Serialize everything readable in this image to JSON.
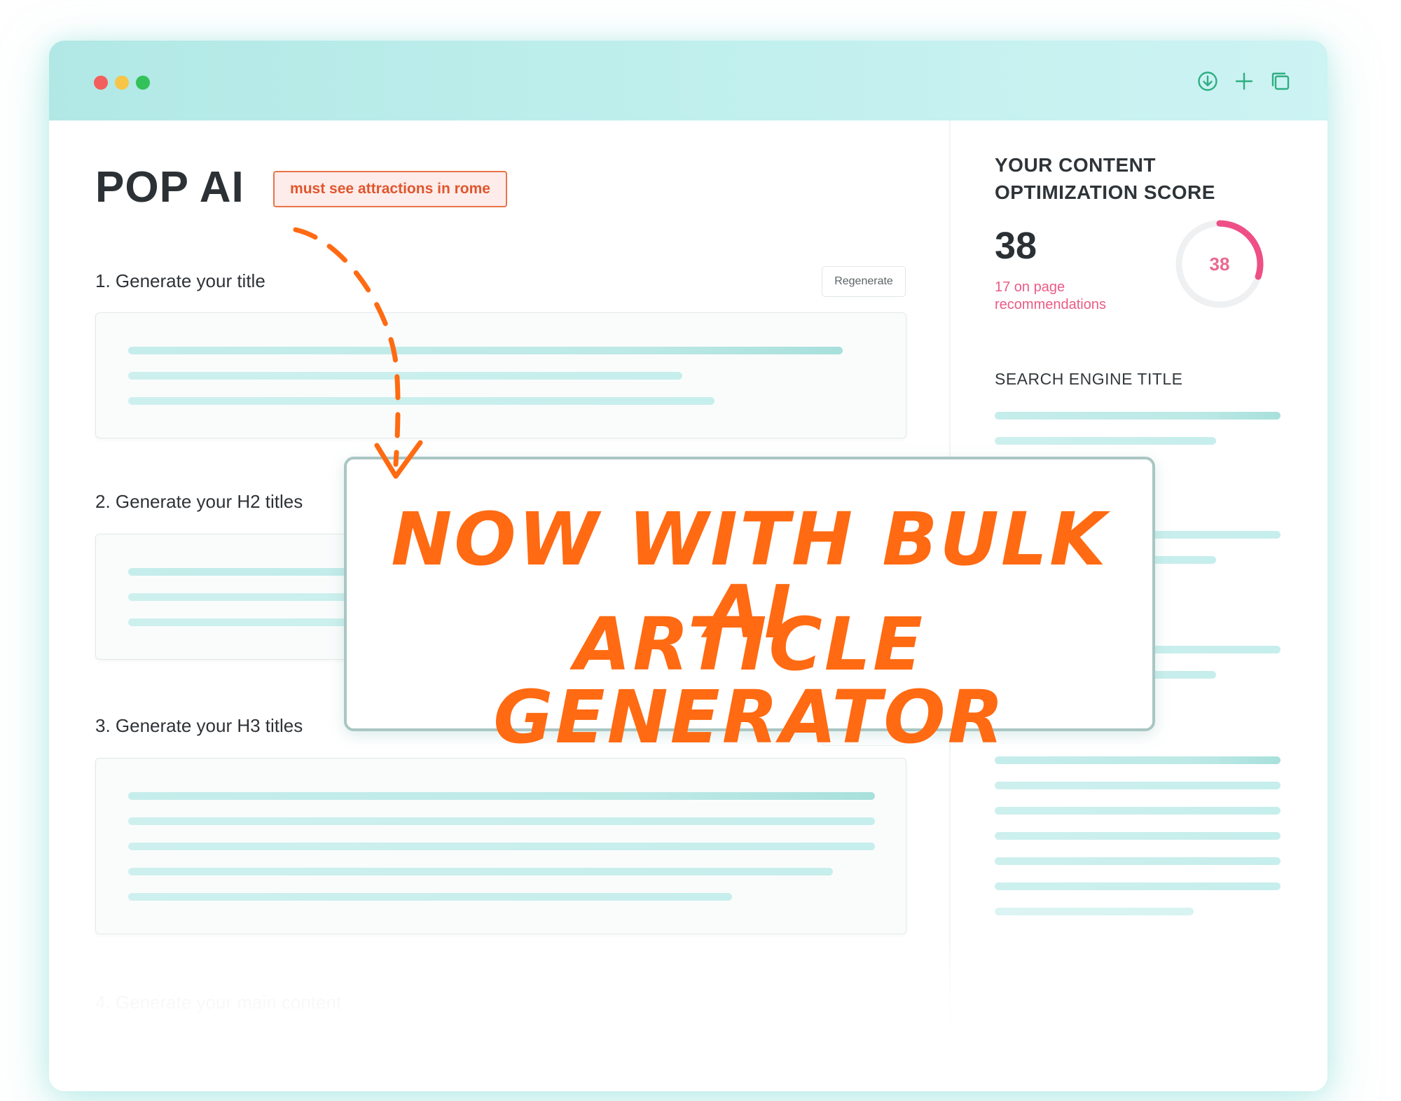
{
  "window": {
    "title_bar_icons": [
      "download-icon",
      "plus-icon",
      "copy-icon"
    ]
  },
  "brand": {
    "name": "POP AI"
  },
  "keyword_tag": "must see attractions in rome",
  "steps": [
    {
      "label": "1. Generate your title",
      "button": "Regenerate"
    },
    {
      "label": "2. Generate your H2 titles"
    },
    {
      "label": "3. Generate your H3 titles"
    },
    {
      "label": "4. Generate your main content"
    }
  ],
  "score_panel": {
    "heading": "YOUR CONTENT OPTIMIZATION SCORE",
    "score": "38",
    "gauge_value": "38",
    "gauge_fraction": 0.3,
    "recommendations": "17 on page recommendations",
    "search_engine_title": "SEARCH ENGINE TITLE"
  },
  "overlay": {
    "line1": "NOW WITH BULK AI",
    "line2": "ARTICLE GENERATOR"
  },
  "colors": {
    "accent_orange": "#ff6a12",
    "tag_red": "#e0562d",
    "score_pink": "#ea5b86",
    "titlebar": "#b1e8e5",
    "placeholder_line": "#c5edeb"
  }
}
